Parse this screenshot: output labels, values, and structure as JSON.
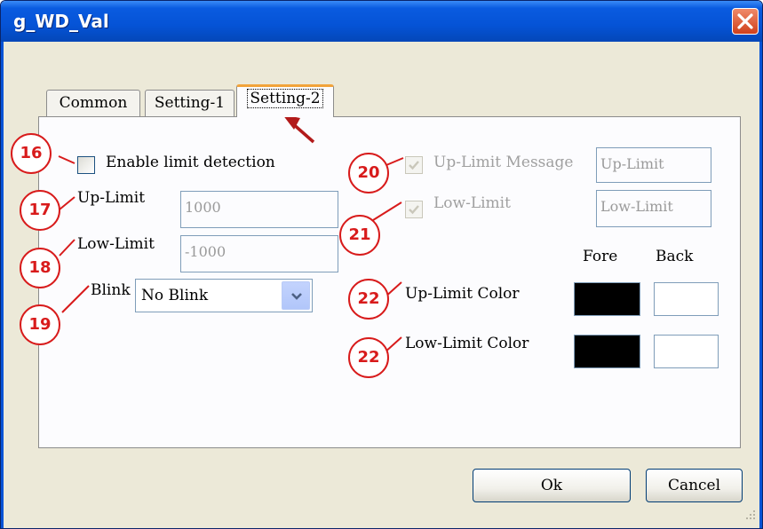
{
  "window": {
    "title": "g_WD_Val"
  },
  "tabs": [
    {
      "label": "Common"
    },
    {
      "label": "Setting-1"
    },
    {
      "label": "Setting-2"
    }
  ],
  "left": {
    "enable_label": "Enable limit detection",
    "enable_checked": false,
    "up_limit_label": "Up-Limit",
    "up_limit_value": "1000",
    "low_limit_label": "Low-Limit",
    "low_limit_value": "-1000",
    "blink_label": "Blink",
    "blink_value": "No Blink"
  },
  "right": {
    "up_msg_label": "Up-Limit Message",
    "up_msg_checked": true,
    "up_msg_value": "Up-Limit",
    "low_msg_label": "Low-Limit",
    "low_msg_checked": true,
    "low_msg_value": "Low-Limit",
    "fore_header": "Fore",
    "back_header": "Back",
    "up_color_label": "Up-Limit Color",
    "low_color_label": "Low-Limit Color",
    "up_fore_color": "#000000",
    "up_back_color": "#ffffff",
    "low_fore_color": "#000000",
    "low_back_color": "#ffffff"
  },
  "buttons": {
    "ok": "Ok",
    "cancel": "Cancel"
  },
  "annotations": {
    "b16": "16",
    "b17": "17",
    "b18": "18",
    "b19": "19",
    "b20": "20",
    "b21": "21",
    "b22a": "22",
    "b22b": "22",
    "color": "#d81b1b"
  }
}
